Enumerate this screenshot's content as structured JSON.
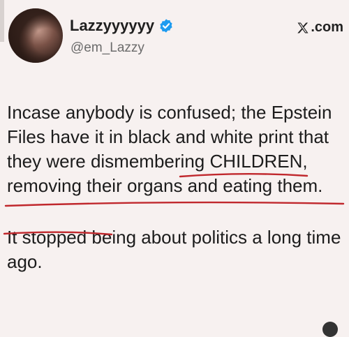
{
  "post": {
    "display_name": "Lazzyyyyyy",
    "handle": "@em_Lazzy",
    "brand": ".com",
    "paragraph1": "Incase anybody is confused; the Epstein Files have it in black and white print that they were dismembering CHILDREN, removing their organs and eating them.",
    "paragraph2": "It stopped being about politics a long time ago."
  },
  "colors": {
    "background": "#f7f1f0",
    "verified_blue": "#1d9bf0",
    "underline_red": "#c0282d",
    "handle_gray": "#6b6b6b"
  },
  "icons": [
    "verified-badge-icon",
    "x-logo-icon"
  ]
}
